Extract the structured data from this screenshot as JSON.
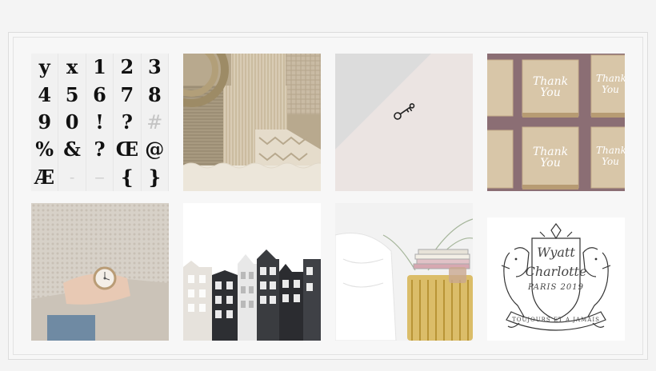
{
  "gallery": {
    "typography": {
      "glyphs": [
        "y",
        "x",
        "1",
        "2",
        "3",
        "4",
        "5",
        "6",
        "7",
        "8",
        "9",
        "0",
        "!",
        "?",
        "#",
        "%",
        "&",
        "?",
        "Œ",
        "@",
        "Æ",
        "–",
        "—",
        "{",
        "}"
      ]
    },
    "crest": {
      "name1": "Wyatt",
      "name2": "Charlotte",
      "place": "PARIS 2019",
      "motto": "TOUJOURS ET A JAMAIS"
    },
    "thankyou": {
      "label": "Thank You"
    },
    "palette": {
      "background": "#f4f4f4",
      "frame": "#dcdcdc",
      "gold": "#d8b75a",
      "kraft": "#d6c3a6"
    }
  }
}
